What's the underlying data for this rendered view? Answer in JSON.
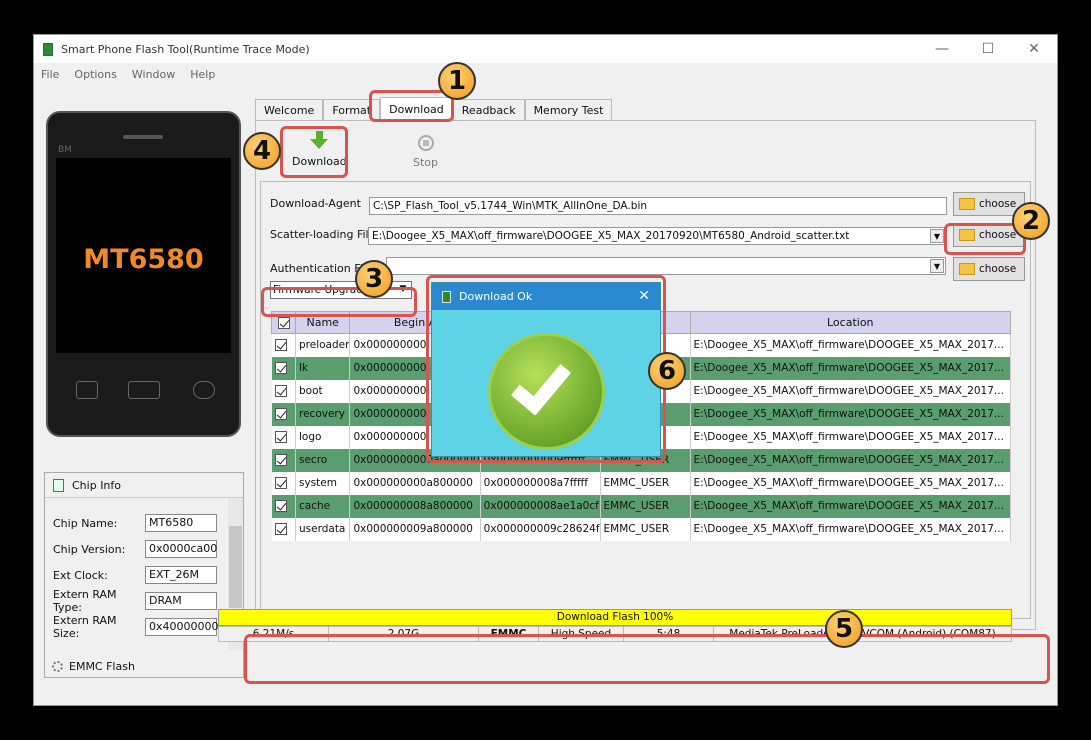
{
  "window": {
    "title": "Smart Phone Flash Tool(Runtime Trace Mode)",
    "min": "—",
    "max": "☐",
    "close": "✕"
  },
  "menu": [
    "File",
    "Options",
    "Window",
    "Help"
  ],
  "phone": {
    "brand": "BM",
    "chip": "MT6580"
  },
  "chip_info": {
    "title": "Chip Info",
    "rows": [
      {
        "k": "Chip Name:",
        "v": "MT6580"
      },
      {
        "k": "Chip Version:",
        "v": "0x0000ca00"
      },
      {
        "k": "Ext Clock:",
        "v": "EXT_26M"
      },
      {
        "k": "Extern RAM Type:",
        "v": "DRAM"
      },
      {
        "k": "Extern RAM Size:",
        "v": "0x40000000"
      }
    ],
    "footer": "EMMC Flash"
  },
  "tabs": [
    "Welcome",
    "Format",
    "Download",
    "Readback",
    "Memory Test"
  ],
  "toolbar": {
    "download": "Download",
    "stop": "Stop"
  },
  "form": {
    "download_agent_label": "Download-Agent",
    "download_agent_value": "C:\\SP_Flash_Tool_v5.1744_Win\\MTK_AllInOne_DA.bin",
    "scatter_label": "Scatter-loading File",
    "scatter_value": "E:\\Doogee_X5_MAX\\off_firmware\\DOOGEE_X5_MAX_20170920\\MT6580_Android_scatter.txt",
    "auth_label": "Authentication File",
    "auth_value": "",
    "choose": "choose",
    "mode": "Firmware Upgrade"
  },
  "table": {
    "headers": [
      "Name",
      "Begin A",
      "",
      "",
      "Location"
    ],
    "rows": [
      {
        "name": "preloader",
        "begin": "0x000000000",
        "end": "",
        "region": "",
        "loc": "E:\\Doogee_X5_MAX\\off_firmware\\DOOGEE_X5_MAX_2017..."
      },
      {
        "name": "lk",
        "begin": "0x000000000",
        "end": "",
        "region": "",
        "loc": "E:\\Doogee_X5_MAX\\off_firmware\\DOOGEE_X5_MAX_2017..."
      },
      {
        "name": "boot",
        "begin": "0x000000000",
        "end": "",
        "region": "",
        "loc": "E:\\Doogee_X5_MAX\\off_firmware\\DOOGEE_X5_MAX_2017..."
      },
      {
        "name": "recovery",
        "begin": "0x000000000",
        "end": "",
        "region": "",
        "loc": "E:\\Doogee_X5_MAX\\off_firmware\\DOOGEE_X5_MAX_2017..."
      },
      {
        "name": "logo",
        "begin": "0x000000000",
        "end": "",
        "region": "",
        "loc": "E:\\Doogee_X5_MAX\\off_firmware\\DOOGEE_X5_MAX_2017..."
      },
      {
        "name": "secro",
        "begin": "0x0000000000a000000",
        "end": "0x0000000009ffffff",
        "region": "EMMC_USER",
        "loc": "E:\\Doogee_X5_MAX\\off_firmware\\DOOGEE_X5_MAX_2017..."
      },
      {
        "name": "system",
        "begin": "0x000000000a800000",
        "end": "0x000000008a7fffff",
        "region": "EMMC_USER",
        "loc": "E:\\Doogee_X5_MAX\\off_firmware\\DOOGEE_X5_MAX_2017..."
      },
      {
        "name": "cache",
        "begin": "0x000000008a800000",
        "end": "0x000000008ae1a0cf",
        "region": "EMMC_USER",
        "loc": "E:\\Doogee_X5_MAX\\off_firmware\\DOOGEE_X5_MAX_2017..."
      },
      {
        "name": "userdata",
        "begin": "0x000000009a800000",
        "end": "0x000000009c28624f",
        "region": "EMMC_USER",
        "loc": "E:\\Doogee_X5_MAX\\off_firmware\\DOOGEE_X5_MAX_2017..."
      }
    ]
  },
  "progress": {
    "text": "Download Flash 100%",
    "percent": 100
  },
  "status": [
    "6.21M/s",
    "2.07G",
    "EMMC",
    "High Speed",
    "5:48",
    "MediaTek PreLoader USB VCOM (Android) (COM87)"
  ],
  "dialog": {
    "title": "Download Ok",
    "close": "✕"
  },
  "badges": [
    "1",
    "2",
    "3",
    "4",
    "5",
    "6"
  ],
  "colors": {
    "highlight": "#d9534f",
    "badge": "#f29a1a",
    "green_row": "#5a9e6f",
    "progress": "#ffff00",
    "dialog": "#5fd3e6"
  }
}
